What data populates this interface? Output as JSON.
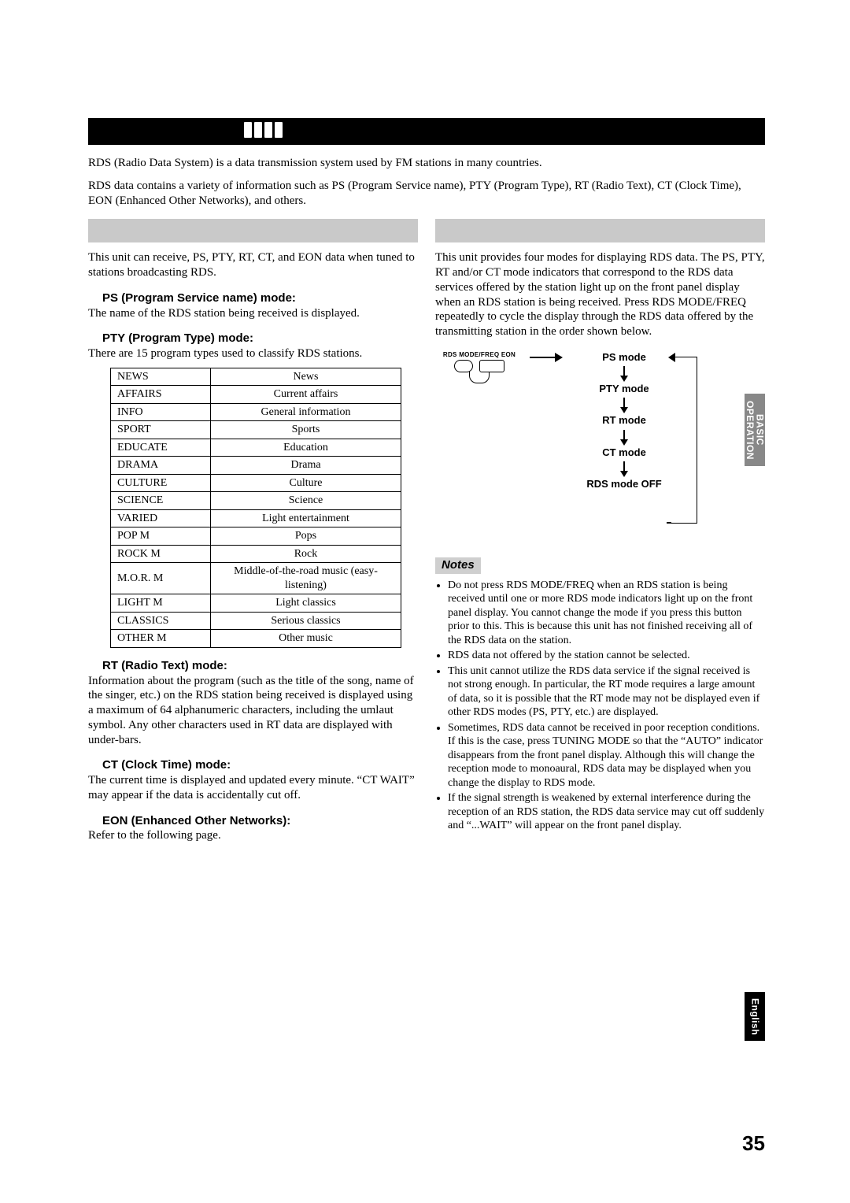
{
  "intro": {
    "p1": "RDS (Radio Data System) is a data transmission system used by FM stations in many countries.",
    "p2": "RDS data contains a variety of information such as PS (Program Service name), PTY (Program Type), RT (Radio Text), CT (Clock Time), EON (Enhanced Other Networks), and others."
  },
  "left": {
    "section_title": " ",
    "lead": "This unit can receive, PS, PTY, RT, CT, and EON data when tuned to stations broadcasting RDS.",
    "ps_hdr": "PS (Program Service name) mode:",
    "ps_body": "The name of the RDS station being received is displayed.",
    "pty_hdr": "PTY (Program Type) mode:",
    "pty_body": "There are 15 program types used to classify RDS stations.",
    "rt_hdr": "RT (Radio Text) mode:",
    "rt_body": "Information about the program (such as the title of the song, name of the singer, etc.) on the RDS station being received is displayed using a maximum of 64 alphanumeric characters, including the umlaut symbol. Any other characters used in RT data are displayed with under-bars.",
    "ct_hdr": "CT (Clock Time) mode:",
    "ct_body": "The current time is displayed and updated every minute. “CT WAIT” may appear if the data is accidentally cut off.",
    "eon_hdr": "EON (Enhanced Other Networks):",
    "eon_body": "Refer to the following page."
  },
  "pty_table": [
    {
      "code": "NEWS",
      "desc": "News"
    },
    {
      "code": "AFFAIRS",
      "desc": "Current affairs"
    },
    {
      "code": "INFO",
      "desc": "General information"
    },
    {
      "code": "SPORT",
      "desc": "Sports"
    },
    {
      "code": "EDUCATE",
      "desc": "Education"
    },
    {
      "code": "DRAMA",
      "desc": "Drama"
    },
    {
      "code": "CULTURE",
      "desc": "Culture"
    },
    {
      "code": "SCIENCE",
      "desc": "Science"
    },
    {
      "code": "VARIED",
      "desc": "Light entertainment"
    },
    {
      "code": "POP M",
      "desc": "Pops"
    },
    {
      "code": "ROCK M",
      "desc": "Rock"
    },
    {
      "code": "M.O.R. M",
      "desc": "Middle-of-the-road music (easy-listening)"
    },
    {
      "code": "LIGHT M",
      "desc": "Light classics"
    },
    {
      "code": "CLASSICS",
      "desc": "Serious classics"
    },
    {
      "code": "OTHER M",
      "desc": "Other music"
    }
  ],
  "right": {
    "section_title": " ",
    "lead": "This unit provides four modes for displaying RDS data. The PS, PTY, RT and/or CT mode indicators that correspond to the RDS data services offered by the station light up on the front panel display when an RDS station is being received. Press RDS MODE/FREQ repeatedly to cycle the display through the RDS data offered by the transmitting station in the order shown below.",
    "btn_label": "RDS MODE/FREQ    EON",
    "modes": [
      "PS mode",
      "PTY mode",
      "RT mode",
      "CT mode",
      "RDS mode OFF"
    ],
    "notes_hdr": "Notes",
    "notes": [
      "Do not press RDS MODE/FREQ when an RDS station is being received until one or more RDS mode indicators light up on the front panel display. You cannot change the mode if you press this button prior to this. This is because this unit has not finished receiving all of the RDS data on the station.",
      "RDS data not offered by the station cannot be selected.",
      "This unit cannot utilize the RDS data service if the signal received is not strong enough. In particular, the RT mode requires a large amount of data, so it is possible that the RT mode may not be displayed even if other RDS modes (PS, PTY, etc.) are displayed.",
      "Sometimes, RDS data cannot be received in poor reception conditions. If this is the case, press TUNING MODE so that the “AUTO” indicator disappears from the front panel display. Although this will change the reception mode to monoaural, RDS data may be displayed when you change the display to RDS mode.",
      "If the signal strength is weakened by external interference during the reception of an RDS station, the RDS data service may cut off suddenly and “...WAIT” will appear on the front panel display."
    ]
  },
  "tabs": {
    "t1a": "BASIC",
    "t1b": "OPERATION",
    "t2": "English"
  },
  "page_number": "35"
}
